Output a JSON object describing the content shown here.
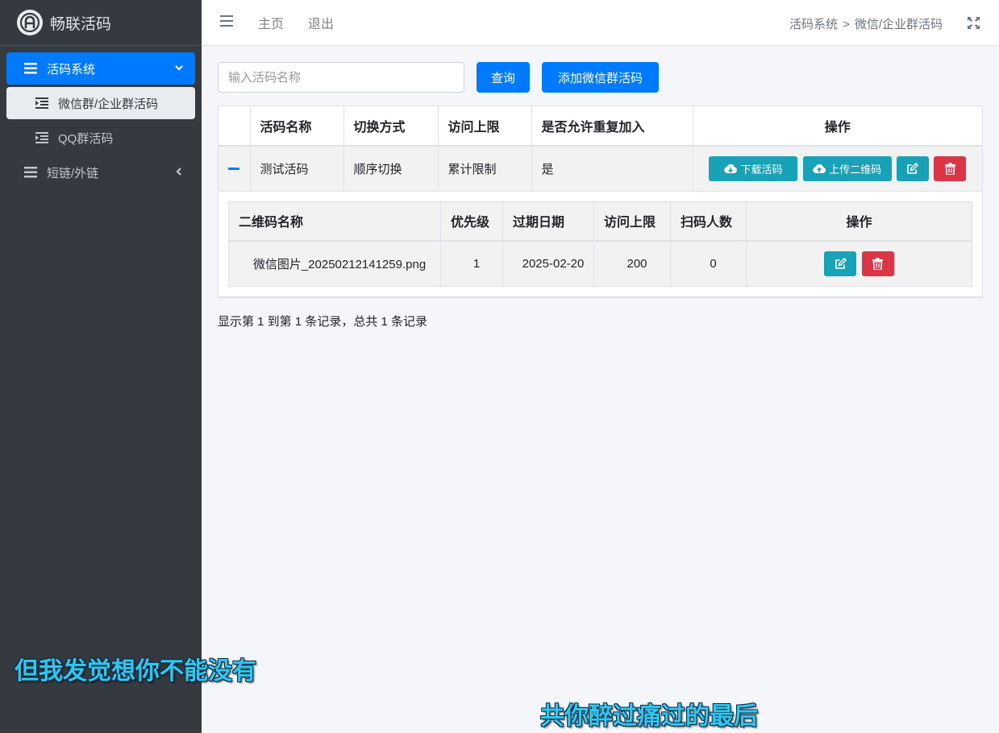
{
  "brand": {
    "name": "畅联活码",
    "logo_letter": "A"
  },
  "sidebar": {
    "items": [
      {
        "label": "活码系统",
        "icon": "list-icon",
        "active": true,
        "expanded": true,
        "children": [
          {
            "label": "微信群/企业群活码",
            "icon": "indent-icon",
            "active": true
          },
          {
            "label": "QQ群活码",
            "icon": "indent-icon",
            "active": false
          }
        ]
      },
      {
        "label": "短链/外链",
        "icon": "list-icon",
        "active": false,
        "expanded": false
      }
    ]
  },
  "header": {
    "links": [
      "主页",
      "退出"
    ],
    "breadcrumb": [
      "活码系统",
      "微信/企业群活码"
    ],
    "breadcrumb_sep": ">"
  },
  "toolbar": {
    "search_placeholder": "输入活码名称",
    "query_label": "查询",
    "add_label": "添加微信群活码"
  },
  "main_table": {
    "columns": [
      "活码名称",
      "切换方式",
      "访问上限",
      "是否允许重复加入",
      "操作"
    ],
    "rows": [
      {
        "name": "测试活码",
        "switch_mode": "顺序切换",
        "limit": "累计限制",
        "allow_repeat": "是",
        "actions": {
          "download": "下载活码",
          "upload": "上传二维码"
        }
      }
    ]
  },
  "sub_table": {
    "columns": [
      "二维码名称",
      "优先级",
      "过期日期",
      "访问上限",
      "扫码人数",
      "操作"
    ],
    "rows": [
      {
        "qr_name": "微信图片_20250212141259.png",
        "priority": "1",
        "expire": "2025-02-20",
        "limit": "200",
        "scans": "0"
      }
    ]
  },
  "pagination_info": "显示第 1 到第 1 条记录，总共 1 条记录",
  "subtitles": [
    "但我发觉想你不能没有",
    "共你醉过痛过的最后"
  ],
  "colors": {
    "primary": "#007bff",
    "info": "#17a2b8",
    "danger": "#dc3545",
    "sidebar": "#343a40",
    "subtitle": "#2fc6ef"
  }
}
